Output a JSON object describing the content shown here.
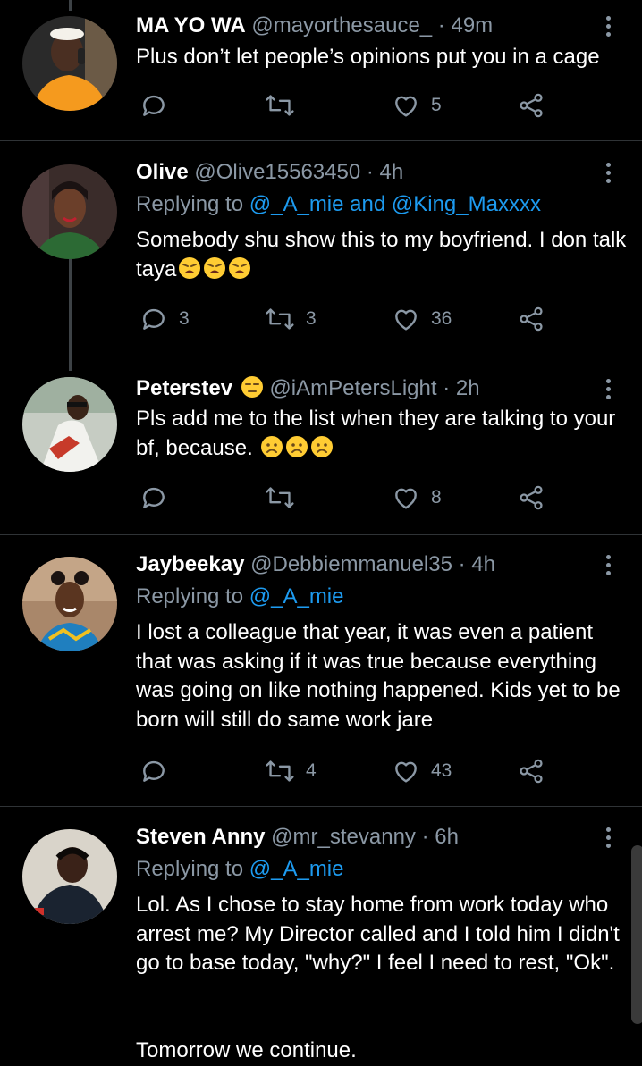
{
  "tweets": [
    {
      "name": "MA YO WA",
      "handle": "@mayorthesauce_",
      "time": " · 49m",
      "replying_label": "",
      "replying_mentions": "",
      "text": "Plus don’t let people’s opinions put you in a cage",
      "reply_count": "",
      "retweet_count": "",
      "like_count": "5",
      "avatar_color": "#f59a1e"
    },
    {
      "name": "Olive",
      "handle": "@Olive15563450",
      "time": " · 4h",
      "replying_label": "Replying to ",
      "replying_mentions": "@_A_mie and @King_Maxxxx",
      "text": "Somebody shu show this to my boyfriend. I don talk taya",
      "emojis": [
        "weary-face",
        "weary-face",
        "weary-face"
      ],
      "reply_count": "3",
      "retweet_count": "3",
      "like_count": "36",
      "avatar_color": "#3a2a2a"
    },
    {
      "name": "Peterstev",
      "name_emoji": "unamused-face",
      "handle": "@iAmPetersLight",
      "time": " · 2h",
      "replying_label": "",
      "replying_mentions": "",
      "text": "Pls add me to the list when they are talking to your bf, because. ",
      "emojis": [
        "worried-face",
        "worried-face",
        "worried-face"
      ],
      "reply_count": "",
      "retweet_count": "",
      "like_count": "8",
      "avatar_color": "#c9d2c8"
    },
    {
      "name": "Jaybeekay",
      "handle": "@Debbiemmanuel35",
      "time": " · 4h",
      "replying_label": "Replying to ",
      "replying_mentions": "@_A_mie",
      "text": "I lost a colleague that year, it was even a patient that was asking if it was true because everything was going on like nothing happened. Kids yet to be born will still do same work jare",
      "reply_count": "",
      "retweet_count": "4",
      "like_count": "43",
      "avatar_color": "#b58b6a"
    },
    {
      "name": "Steven Anny",
      "handle": "@mr_stevanny",
      "time": " · 6h",
      "replying_label": "Replying to ",
      "replying_mentions": "@_A_mie",
      "text": "Lol. As I chose to stay home from work today who arrest me? My Director called and I told him I didn't go to base today, \"why?\" I feel I need to rest, \"Ok\".",
      "text2": "Tomorrow we continue.",
      "avatar_color": "#d8d4cc"
    }
  ],
  "colors": {
    "background": "#000000",
    "secondary_text": "#8b98a5",
    "link": "#1d9bf0",
    "divider": "#2f3336"
  },
  "icons": [
    "reply-icon",
    "retweet-icon",
    "like-icon",
    "share-icon",
    "more-icon"
  ]
}
